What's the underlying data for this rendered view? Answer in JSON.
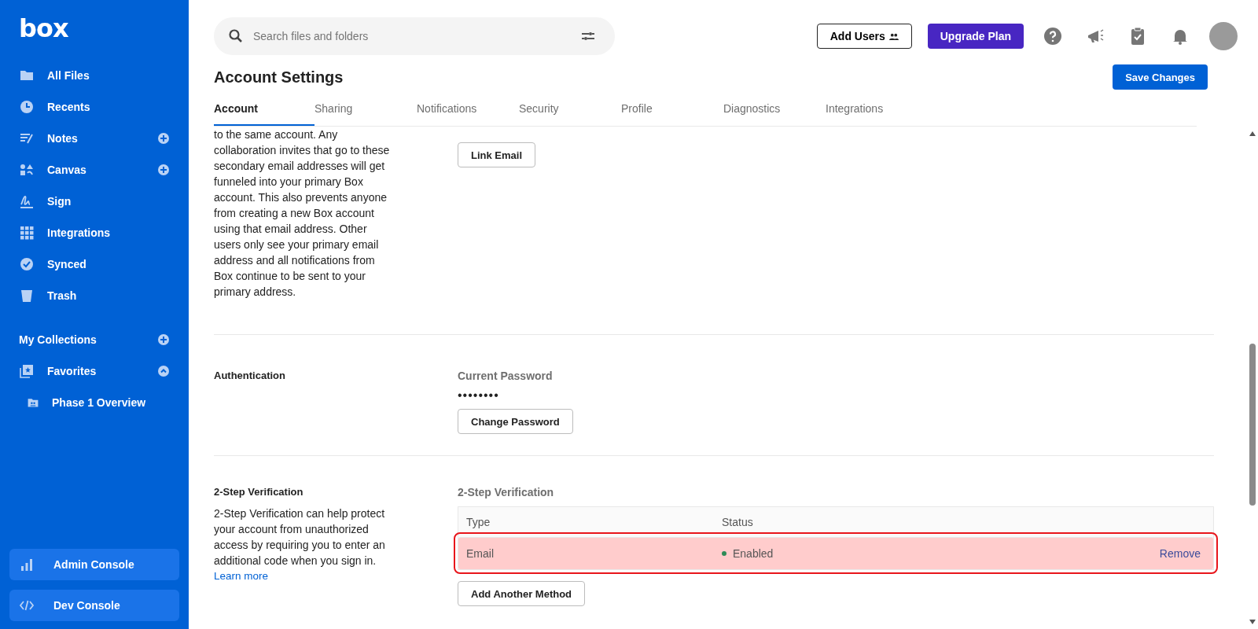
{
  "sidebar": {
    "logo": "box",
    "items": [
      {
        "label": "All Files",
        "kind": "folder",
        "add": false
      },
      {
        "label": "Recents",
        "kind": "clock",
        "add": false
      },
      {
        "label": "Notes",
        "kind": "notes",
        "add": true
      },
      {
        "label": "Canvas",
        "kind": "shapes",
        "add": true
      },
      {
        "label": "Sign",
        "kind": "sign",
        "add": false
      },
      {
        "label": "Integrations",
        "kind": "grid",
        "add": false
      },
      {
        "label": "Synced",
        "kind": "check",
        "add": false
      },
      {
        "label": "Trash",
        "kind": "trash",
        "add": false
      }
    ],
    "collections": {
      "label": "My Collections",
      "favorites": {
        "label": "Favorites",
        "expanded": true,
        "children": [
          {
            "label": "Phase 1 Overview"
          }
        ]
      }
    },
    "consoles": [
      {
        "label": "Admin Console",
        "kind": "bars"
      },
      {
        "label": "Dev Console",
        "kind": "code"
      }
    ]
  },
  "header": {
    "search": {
      "placeholder": "Search files and folders"
    },
    "add_users": "Add Users",
    "upgrade": "Upgrade Plan"
  },
  "page": {
    "title": "Account Settings",
    "save": "Save Changes",
    "tabs": [
      {
        "label": "Account",
        "selected": true
      },
      {
        "label": "Sharing",
        "selected": false
      },
      {
        "label": "Notifications",
        "selected": false
      },
      {
        "label": "Security",
        "selected": false
      },
      {
        "label": "Profile",
        "selected": false
      },
      {
        "label": "Diagnostics",
        "selected": false
      },
      {
        "label": "Integrations",
        "selected": false
      }
    ]
  },
  "email_section": {
    "description": "to the same account. Any collaboration invites that go to these secondary email addresses will get funneled into your primary Box account. This also prevents anyone from creating a new Box account using that email address. Other users only see your primary email address and all notifications from Box continue to be sent to your primary address.",
    "button": "Link Email"
  },
  "authentication": {
    "label": "Authentication",
    "field_label": "Current Password",
    "value": "••••••••",
    "button": "Change Password"
  },
  "two_step": {
    "label": "2-Step Verification",
    "description": "2-Step Verification can help protect your account from unauthorized access by requiring you to enter an additional code when you sign in.",
    "link": "Learn more",
    "table_title": "2-Step Verification",
    "columns": [
      "Type",
      "Status"
    ],
    "rows": [
      {
        "type": "Email",
        "status": "Enabled",
        "color": "#2e8b57",
        "action": "Remove",
        "highlighted": true
      }
    ],
    "button": "Add Another Method"
  }
}
